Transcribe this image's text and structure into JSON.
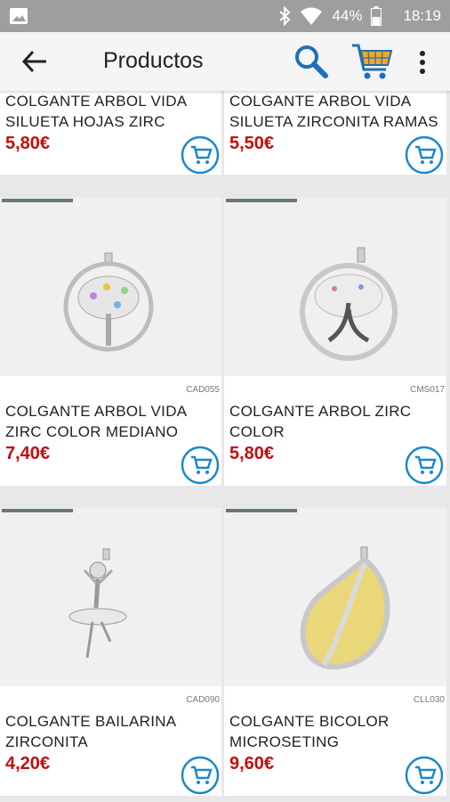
{
  "status": {
    "battery": "44%",
    "time": "18:19"
  },
  "appbar": {
    "title": "Productos"
  },
  "products": [
    {
      "name_line1": "COLGANTE ARBOL VIDA",
      "name_line2": "SILUETA HOJAS ZIRC",
      "price": "5,80€",
      "code": ""
    },
    {
      "name_line1": "COLGANTE ARBOL VIDA",
      "name_line2": "SILUETA ZIRCONITA RAMAS",
      "price": "5,50€",
      "code": ""
    },
    {
      "name_line1": "COLGANTE ARBOL VIDA",
      "name_line2": "ZIRC COLOR MEDIANO",
      "price": "7,40€",
      "code": "CAD055"
    },
    {
      "name_line1": "COLGANTE ARBOL ZIRC",
      "name_line2": "COLOR",
      "price": "5,80€",
      "code": "CMS017"
    },
    {
      "name_line1": "COLGANTE BAILARINA",
      "name_line2": "ZIRCONITA",
      "price": "4,20€",
      "code": "CAD090"
    },
    {
      "name_line1": "COLGANTE BICOLOR",
      "name_line2": "MICROSETING",
      "price": "9,60€",
      "code": "CLL030"
    }
  ]
}
